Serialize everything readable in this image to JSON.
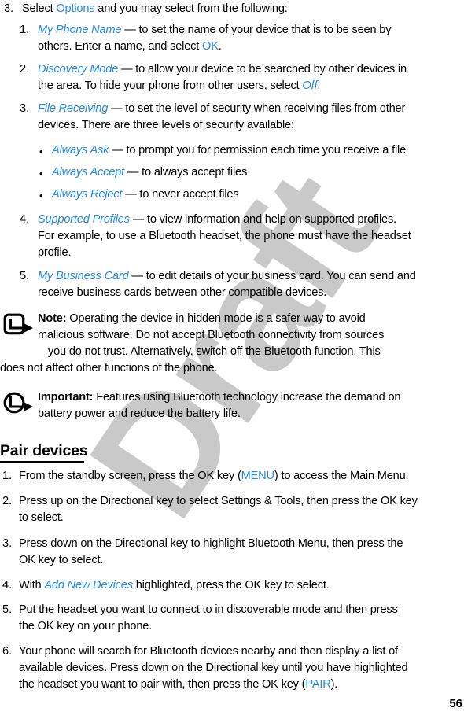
{
  "document": {
    "page_number": "56",
    "watermark": "Draft",
    "accent_color": "#2689e6",
    "watermark_color": "#c9c9c9"
  },
  "step3": {
    "marker": "3.",
    "lead_plain_1": "Select ",
    "lead_link": "Options",
    "lead_plain_2": " and you may select from the following:"
  },
  "options": [
    {
      "marker": "1.",
      "term": "My Phone Name",
      "lines": [
        " — to set the name of your device that is to be seen by",
        "others. Enter a name, and select "
      ],
      "tail_link": "OK",
      "tail_plain": "."
    },
    {
      "marker": "2.",
      "term": "Discovery Mode",
      "lines": [
        " — to allow your device to be searched by other devices in",
        "the area. To hide your phone from other users, select "
      ],
      "tail_link": "Off",
      "tail_plain": "."
    },
    {
      "marker": "3.",
      "term": "File Receiving",
      "lines": [
        " — to set the level of security when receiving files from other",
        "devices. There are three levels of security available:"
      ],
      "tail_link": "",
      "tail_plain": ""
    },
    {
      "marker": "4.",
      "term": "Supported Profiles",
      "lines": [
        " — to view information and help on supported profiles.",
        "For example, to use a Bluetooth headset, the phone must have the headset",
        "profile."
      ],
      "tail_link": "",
      "tail_plain": ""
    },
    {
      "marker": "5.",
      "term": "My Business Card",
      "lines": [
        " — to edit details of your business card. You can send and",
        "receive business cards between other compatible devices."
      ],
      "tail_link": "",
      "tail_plain": ""
    }
  ],
  "security_levels": [
    {
      "bullet": "•",
      "term": "Always Ask",
      "text": " — to prompt you for permission each time you receive a file"
    },
    {
      "bullet": "•",
      "term": "Always Accept",
      "text": " — to always accept files"
    },
    {
      "bullet": "•",
      "term": "Always Reject",
      "text": " — to never accept files"
    }
  ],
  "note": {
    "icon": "note-arrow-icon",
    "label": "Note:",
    "lines": [
      " Operating the device in hidden mode is a safer way to avoid",
      "malicious software. Do not accept Bluetooth connectivity from sources",
      "you do not trust. Alternatively, switch off the Bluetooth function. This",
      "does not affect other functions of the phone."
    ]
  },
  "important": {
    "icon": "important-arrow-icon",
    "label": "Important:",
    "lines": [
      " Features using Bluetooth technology increase the demand on",
      "battery power and reduce the battery life."
    ]
  },
  "pair_devices": {
    "heading": "Pair devices",
    "steps": [
      {
        "marker": "1.",
        "lines": [
          {
            "parts": [
              {
                "t": "From the standby screen, press the OK key (",
                "k": "plain"
              },
              {
                "t": "MENU",
                "k": "link"
              },
              {
                "t": ") to access the Main Menu.",
                "k": "plain"
              }
            ]
          }
        ]
      },
      {
        "marker": "2.",
        "lines": [
          {
            "parts": [
              {
                "t": "Press up on the Directional key to select Settings & Tools, then press the OK key",
                "k": "plain"
              }
            ]
          },
          {
            "parts": [
              {
                "t": "to select.",
                "k": "plain"
              }
            ]
          }
        ]
      },
      {
        "marker": "3.",
        "lines": [
          {
            "parts": [
              {
                "t": "Press down on the Directional key to highlight Bluetooth Menu, then press the",
                "k": "plain"
              }
            ]
          },
          {
            "parts": [
              {
                "t": "OK key to select.",
                "k": "plain"
              }
            ]
          }
        ]
      },
      {
        "marker": "4.",
        "lines": [
          {
            "parts": [
              {
                "t": "With ",
                "k": "plain"
              },
              {
                "t": "Add New Devices",
                "k": "ital"
              },
              {
                "t": " highlighted, press the OK key to select.",
                "k": "plain"
              }
            ]
          }
        ]
      },
      {
        "marker": "5.",
        "lines": [
          {
            "parts": [
              {
                "t": "Put the headset you want to connect to in discoverable mode and then press",
                "k": "plain"
              }
            ]
          },
          {
            "parts": [
              {
                "t": "the OK key on your phone.",
                "k": "plain"
              }
            ]
          }
        ]
      },
      {
        "marker": "6.",
        "lines": [
          {
            "parts": [
              {
                "t": "Your phone will search for Bluetooth devices nearby and then display a list of",
                "k": "plain"
              }
            ]
          },
          {
            "parts": [
              {
                "t": "available devices. Press down on the Directional key until you have highlighted",
                "k": "plain"
              }
            ]
          },
          {
            "parts": [
              {
                "t": "the headset you want to pair with, then press the OK key (",
                "k": "plain"
              },
              {
                "t": "PAIR",
                "k": "link"
              },
              {
                "t": ").",
                "k": "plain"
              }
            ]
          }
        ]
      }
    ]
  }
}
